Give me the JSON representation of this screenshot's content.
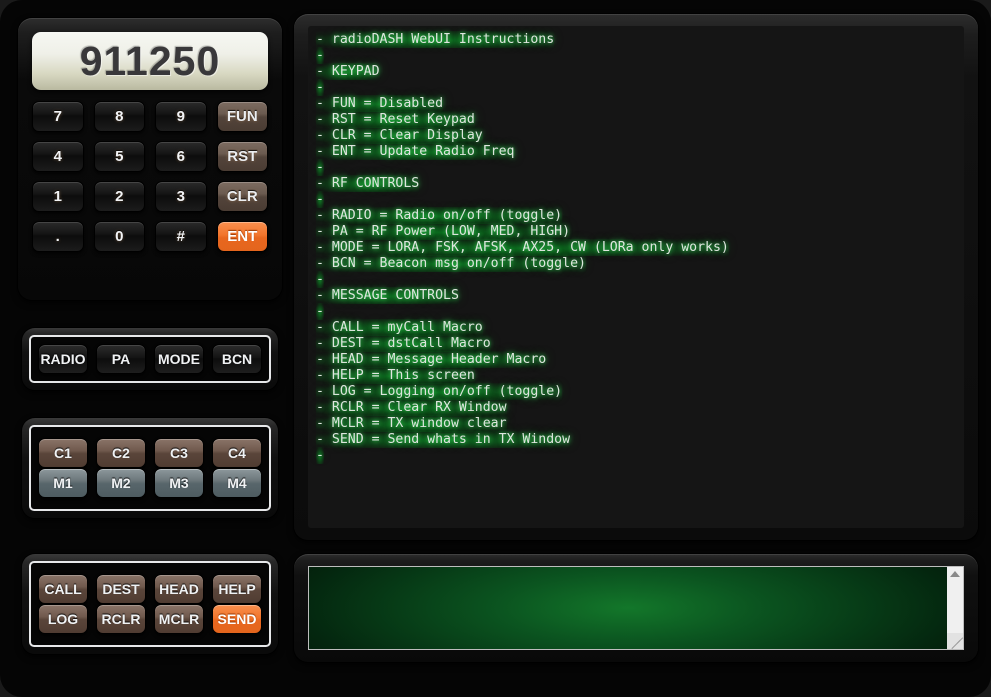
{
  "keypad": {
    "display_value": "911250",
    "rows": [
      [
        {
          "label": "7",
          "kind": "num"
        },
        {
          "label": "8",
          "kind": "num"
        },
        {
          "label": "9",
          "kind": "num"
        },
        {
          "label": "FUN",
          "kind": "fn"
        }
      ],
      [
        {
          "label": "4",
          "kind": "num"
        },
        {
          "label": "5",
          "kind": "num"
        },
        {
          "label": "6",
          "kind": "num"
        },
        {
          "label": "RST",
          "kind": "fn"
        }
      ],
      [
        {
          "label": "1",
          "kind": "num"
        },
        {
          "label": "2",
          "kind": "num"
        },
        {
          "label": "3",
          "kind": "num"
        },
        {
          "label": "CLR",
          "kind": "fn"
        }
      ],
      [
        {
          "label": ".",
          "kind": "num"
        },
        {
          "label": "0",
          "kind": "num"
        },
        {
          "label": "#",
          "kind": "num"
        },
        {
          "label": "ENT",
          "kind": "accent"
        }
      ]
    ]
  },
  "rf_controls": {
    "rows": [
      [
        {
          "label": "RADIO",
          "kind": "dark"
        },
        {
          "label": "PA",
          "kind": "dark"
        },
        {
          "label": "MODE",
          "kind": "dark"
        },
        {
          "label": "BCN",
          "kind": "dark"
        }
      ]
    ]
  },
  "macro_controls": {
    "rows": [
      [
        {
          "label": "C1",
          "kind": "brown"
        },
        {
          "label": "C2",
          "kind": "brown"
        },
        {
          "label": "C3",
          "kind": "brown"
        },
        {
          "label": "C4",
          "kind": "brown"
        }
      ],
      [
        {
          "label": "M1",
          "kind": "slate"
        },
        {
          "label": "M2",
          "kind": "slate"
        },
        {
          "label": "M3",
          "kind": "slate"
        },
        {
          "label": "M4",
          "kind": "slate"
        }
      ]
    ]
  },
  "message_controls": {
    "rows": [
      [
        {
          "label": "CALL",
          "kind": "brown"
        },
        {
          "label": "DEST",
          "kind": "brown"
        },
        {
          "label": "HEAD",
          "kind": "brown"
        },
        {
          "label": "HELP",
          "kind": "brown"
        }
      ],
      [
        {
          "label": "LOG",
          "kind": "brown"
        },
        {
          "label": "RCLR",
          "kind": "brown"
        },
        {
          "label": "MCLR",
          "kind": "brown"
        },
        {
          "label": "SEND",
          "kind": "accent"
        }
      ]
    ]
  },
  "rx_window": {
    "lines": [
      "- radioDASH WebUI Instructions",
      "-",
      "- KEYPAD",
      "-",
      "- FUN = Disabled",
      "- RST = Reset Keypad",
      "- CLR = Clear Display",
      "- ENT = Update Radio Freq",
      "-",
      "- RF CONTROLS",
      "-",
      "- RADIO = Radio on/off (toggle)",
      "- PA = RF Power (LOW, MED, HIGH)",
      "- MODE = LORA, FSK, AFSK, AX25, CW (LORa only works)",
      "- BCN = Beacon msg on/off (toggle)",
      "-",
      "- MESSAGE CONTROLS",
      "-",
      "- CALL = myCall Macro",
      "- DEST = dstCall Macro",
      "- HEAD = Message Header Macro",
      "- HELP = This screen",
      "- LOG = Logging on/off (toggle)",
      "- RCLR = Clear RX Window",
      "- MCLR = TX window clear",
      "- SEND = Send whats in TX Window",
      "-"
    ]
  },
  "tx_window": {
    "value": "",
    "placeholder": ""
  },
  "colors": {
    "accent_orange": "#f2752c",
    "brown_button": "#70594d",
    "slate_button": "#6d787c",
    "terminal_green": "#13772a",
    "glow_green": "#46ff6e"
  }
}
